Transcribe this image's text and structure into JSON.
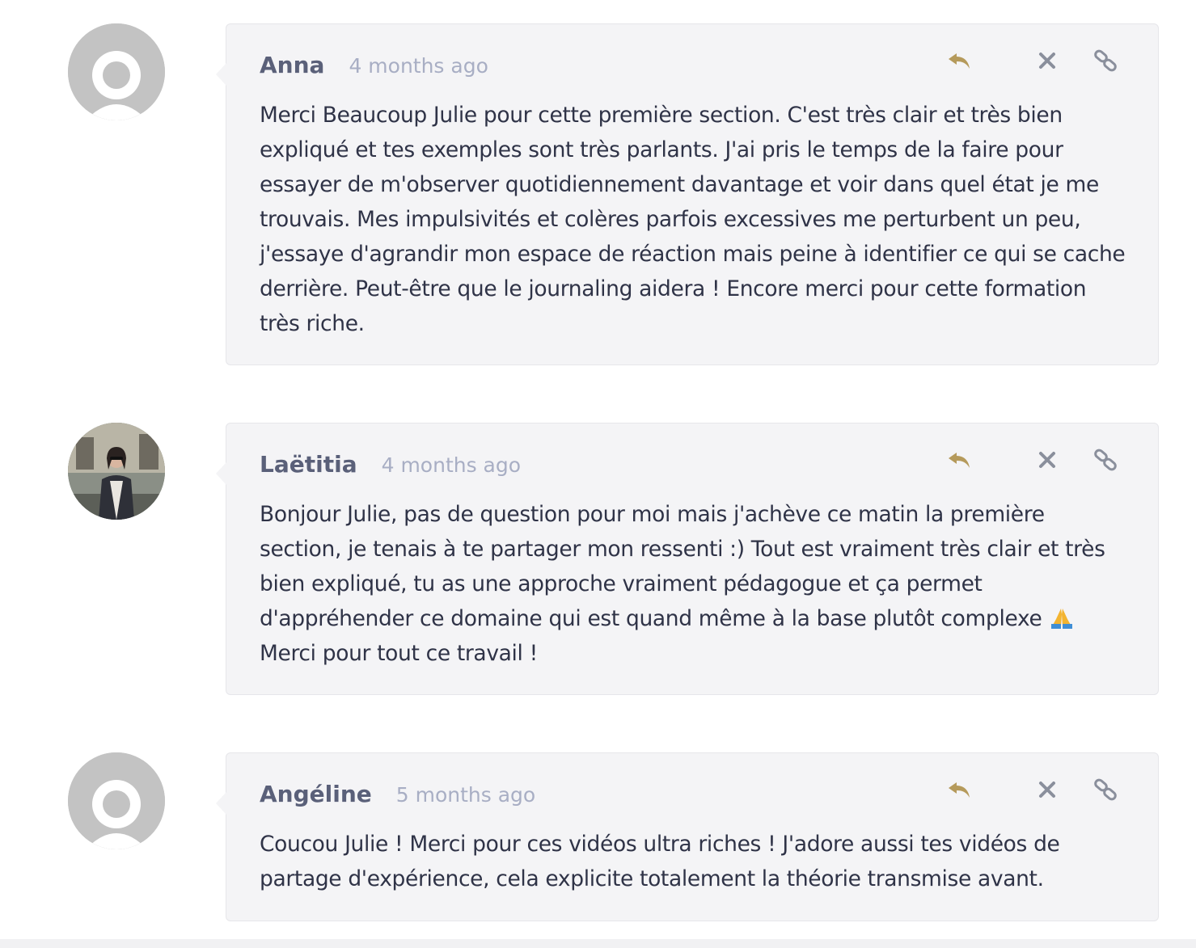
{
  "comments": [
    {
      "author": "Anna",
      "time": "4 months ago",
      "avatar": "default-avatar",
      "text": "Merci Beaucoup Julie pour cette première section. C'est très clair et très bien expliqué et tes exemples sont très parlants. J'ai pris le temps de la faire pour essayer de m'observer quotidiennement davantage et voir dans quel état je me trouvais. Mes impulsivités et colères parfois excessives me perturbent un peu, j'essaye d'agrandir mon espace de réaction mais peine à identifier ce qui se cache derrière. Peut-être que le journaling aidera ! Encore merci pour cette formation très riche."
    },
    {
      "author": "Laëtitia",
      "time": "4 months ago",
      "avatar": "photo-avatar",
      "text_before_emoji": "Bonjour Julie, pas de question pour moi mais j'achève ce matin la première section, je tenais à te partager mon ressenti :) Tout est vraiment très clair et très bien expliqué, tu as une approche vraiment pédagogue et ça permet d'appréhender ce domaine qui est quand même à la base plutôt complexe ",
      "emoji": "folded-hands-emoji",
      "text_after_emoji": " Merci pour tout ce travail !"
    },
    {
      "author": "Angéline",
      "time": "5 months ago",
      "avatar": "default-avatar",
      "text": "Coucou Julie ! Merci pour ces vidéos ultra riches ! J'adore aussi tes vidéos de partage d'expérience, cela explicite totalement la théorie transmise avant."
    }
  ],
  "colors": {
    "reply_icon": "#b59a5b",
    "action_icon": "#8a8f9c",
    "author": "#5a6079",
    "timestamp": "#a8aec4",
    "body_text": "#2f3347",
    "bubble_bg": "#f4f4f6"
  },
  "icons": {
    "reply": "reply-icon",
    "delete": "close-icon",
    "permalink": "link-icon"
  }
}
